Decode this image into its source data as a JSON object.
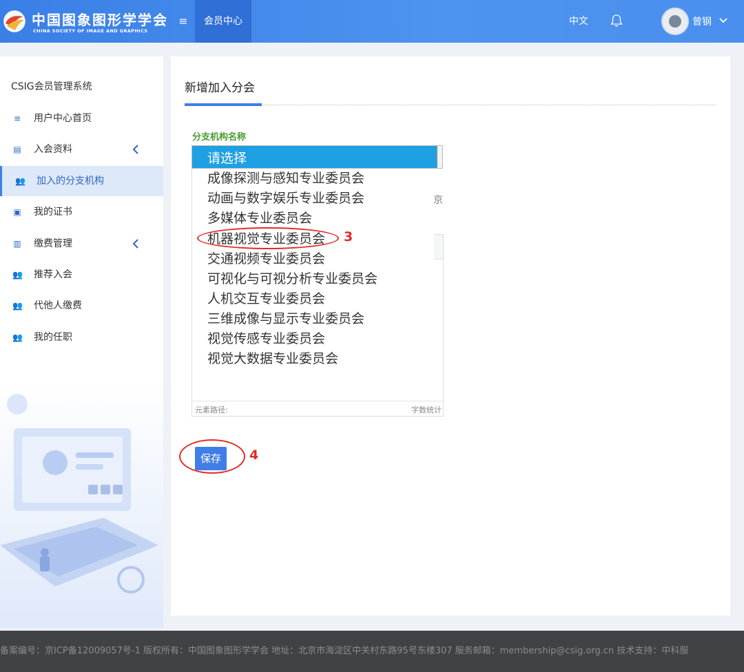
{
  "header": {
    "logo_cn": "中国图象图形学学会",
    "logo_en": "CHINA SOCIETY OF IMAGE AND GRAPHICS",
    "menu_icon": "menu-icon",
    "nav_active": "会员中心",
    "language": "中文",
    "notification_icon": "bell-icon",
    "user_name": "曾钢"
  },
  "sidebar": {
    "title": "CSIG会员管理系统",
    "items": [
      {
        "label": "用户中心首页",
        "icon": "list-icon"
      },
      {
        "label": "入会资料",
        "icon": "profile-icon",
        "expandable": true
      },
      {
        "label": "加入的分支机构",
        "icon": "users-icon",
        "active": true
      },
      {
        "label": "我的证书",
        "icon": "certificate-icon"
      },
      {
        "label": "缴费管理",
        "icon": "payment-icon",
        "expandable": true
      },
      {
        "label": "推荐入会",
        "icon": "users-icon"
      },
      {
        "label": "代他人缴费",
        "icon": "users-icon"
      },
      {
        "label": "我的任职",
        "icon": "users-icon"
      }
    ]
  },
  "main": {
    "title": "新增加入分会",
    "field_label": "分支机构名称",
    "select_value": "请选择",
    "options": [
      "成像探测与感知专业委员会",
      "动画与数字娱乐专业委员会",
      "多媒体专业委员会",
      "机器视觉专业委员会",
      "交通视频专业委员会",
      "可视化与可视分析专业委员会",
      "人机交互专业委员会",
      "三维成像与显示专业委员会",
      "视觉传感专业委员会",
      "视觉大数据专业委员会"
    ],
    "stray_char": "京",
    "editor_path": "元素路径:",
    "editor_count": "字数统计",
    "save_label": "保存"
  },
  "annotations": {
    "step3": "3",
    "step4": "4",
    "color": "#e32a2a"
  },
  "footer": {
    "text": "备案编号：京ICP备12009057号-1 版权所有：中国图象图形学学会 地址：北京市海淀区中关村东路95号东楼307 服务邮箱：membership@csig.org.cn 技术支持：中科服"
  }
}
